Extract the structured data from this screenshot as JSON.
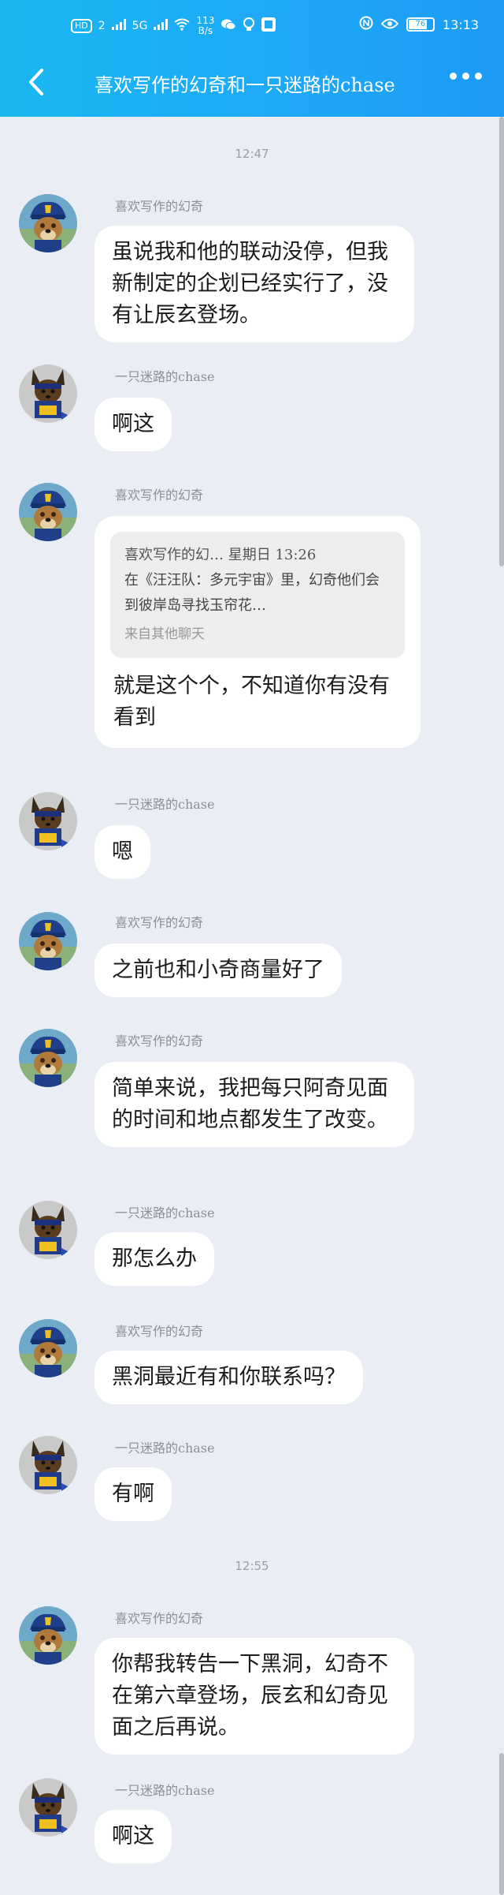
{
  "status_bar": {
    "network": "HD",
    "sim": "2",
    "signal_label": "5G",
    "speed_value": "113",
    "speed_unit": "B/s",
    "battery": "76",
    "time": "13:13"
  },
  "header": {
    "title": "喜欢写作的幻奇和一只迷路的chase"
  },
  "conversation": [
    {
      "type": "time",
      "text": "12:47"
    },
    {
      "type": "msg",
      "sender": "喜欢写作的幻奇",
      "avatar": "a",
      "text": "虽说我和他的联动没停，但我新制定的企划已经实行了，没有让辰玄登场。"
    },
    {
      "type": "msg",
      "sender": "一只迷路的chase",
      "avatar": "b",
      "text": "啊这"
    },
    {
      "type": "msg",
      "sender": "喜欢写作的幻奇",
      "avatar": "a",
      "quote": {
        "head": "喜欢写作的幻… 星期日 13:26",
        "body": "在《汪汪队：多元宇宙》里，幻奇他们会到彼岸岛寻找玉帘花…",
        "source": "来自其他聊天"
      },
      "text": "就是这个个，不知道你有没有看到"
    },
    {
      "type": "msg",
      "sender": "一只迷路的chase",
      "avatar": "b",
      "text": "嗯"
    },
    {
      "type": "msg",
      "sender": "喜欢写作的幻奇",
      "avatar": "a",
      "text": "之前也和小奇商量好了"
    },
    {
      "type": "msg",
      "sender": "喜欢写作的幻奇",
      "avatar": "a",
      "text": "简单来说，我把每只阿奇见面的时间和地点都发生了改变。"
    },
    {
      "type": "msg",
      "sender": "一只迷路的chase",
      "avatar": "b",
      "text": "那怎么办"
    },
    {
      "type": "msg",
      "sender": "喜欢写作的幻奇",
      "avatar": "a",
      "text": "黑洞最近有和你联系吗？"
    },
    {
      "type": "msg",
      "sender": "一只迷路的chase",
      "avatar": "b",
      "text": "有啊"
    },
    {
      "type": "time",
      "text": "12:55"
    },
    {
      "type": "msg",
      "sender": "喜欢写作的幻奇",
      "avatar": "a",
      "text": "你帮我转告一下黑洞，幻奇不在第六章登场，辰玄和幻奇见面之后再说。"
    },
    {
      "type": "msg",
      "sender": "一只迷路的chase",
      "avatar": "b",
      "text": "啊这"
    }
  ],
  "colors": {
    "header": "#1ea9f7",
    "background": "#eaedf4",
    "bubble": "#ffffff"
  }
}
